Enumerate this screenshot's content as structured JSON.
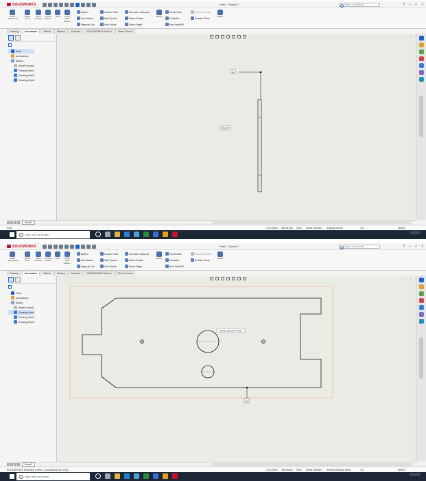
{
  "app": {
    "logo": "SOLIDWORKS",
    "search_placeholder": "Search Commands",
    "window_controls": [
      "?",
      "–",
      "□",
      "×"
    ]
  },
  "ribbon": {
    "big": [
      "Smart Dimension",
      "Model Items",
      "Spell Checker",
      "Format Painter",
      "Note",
      "Linear Note Pattern"
    ],
    "col1": [
      "Balloon",
      "Auto Balloon",
      "Magnetic Line"
    ],
    "col2": [
      "Surface Finish",
      "Weld Symbol",
      "Hole Callout"
    ],
    "col3": [
      "Geometric Tolerance",
      "Datum Feature",
      "Datum Target"
    ],
    "blocks": "Blocks",
    "col4": [
      "Center Mark",
      "Centerline",
      "Area Hatch/Fill"
    ],
    "col5": [
      "Revision Symbol",
      "Revision Cloud"
    ],
    "tables": "Tables"
  },
  "tabs": [
    "Drawing",
    "Annotation",
    "Sketch",
    "Markup",
    "Evaluate",
    "SOLIDWORKS Add-Ins",
    "Sheet Format"
  ],
  "tree": {
    "root": "Part1",
    "annotations": "Annotations",
    "sheet": "Sheet1",
    "sheet_format": "Sheet Format1",
    "views": [
      "Drawing View1",
      "Drawing View2",
      "Drawing View3"
    ]
  },
  "sheet_tab": "Sheet1",
  "taskbar": {
    "search_placeholder": "Type here to search"
  },
  "screens": [
    {
      "title": "Part1 - Sheet1 *",
      "selected_item": "Part1",
      "labels": {
        "view_letter": "A",
        "tag": "Sheet1"
      },
      "status": {
        "left": "Part1",
        "x": "713.75mm",
        "y": "305.41mm",
        "z": "0mm",
        "state": "Under Defined",
        "editing": "Editing Sheet1",
        "scale": "1:2",
        "units": "MMGS",
        "time": "",
        "date": ""
      }
    },
    {
      "title": "Part1 - Sheet1 *",
      "selected_item": "Drawing View1",
      "labels": {
        "view_letter": "B",
        "tag": "Sheet Callouts of Part1"
      },
      "status": {
        "left": "SOLIDWORKS Education Edition - Instructional Use Only",
        "x": "218.22mm",
        "y": "166.38mm",
        "z": "0mm",
        "state": "Under Defined",
        "editing": "Editing Drawing View1",
        "scale": "1:2",
        "units": "MMGS",
        "time": "",
        "date": ""
      }
    }
  ],
  "colors": {
    "brand": "#c8102e",
    "accent": "#1f62c7",
    "taskbar": "#1c2635",
    "sheet": "#ebebe6",
    "sheet_border": "#e7b98f"
  }
}
